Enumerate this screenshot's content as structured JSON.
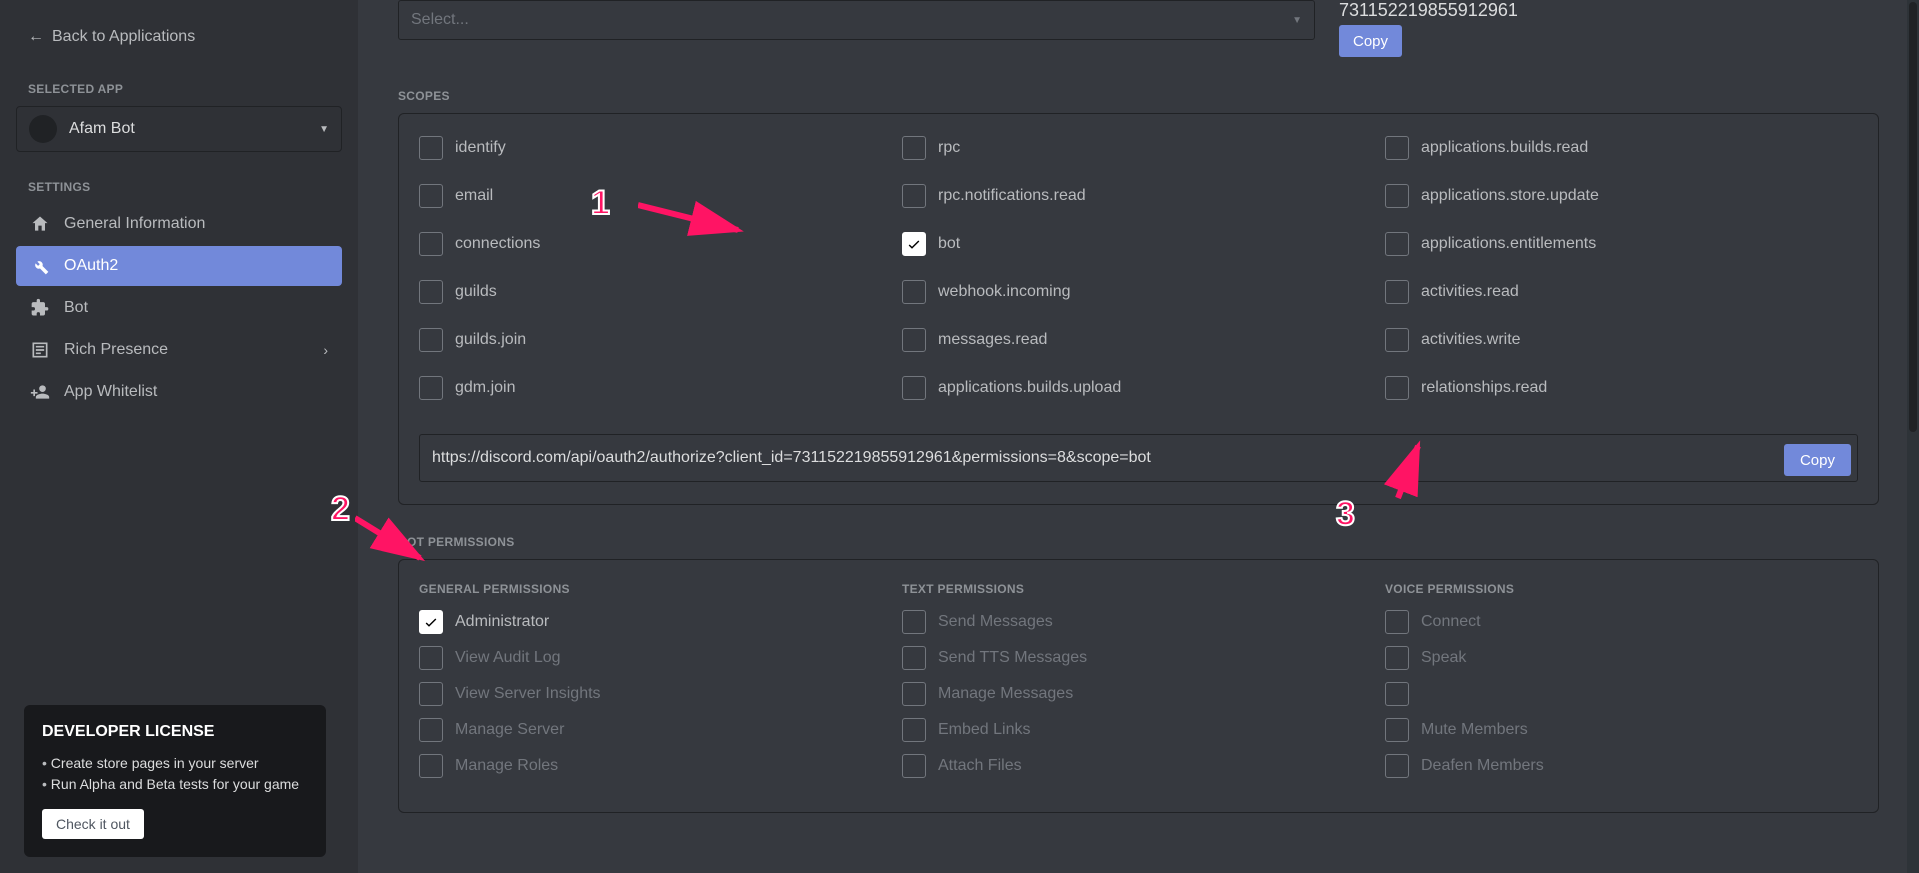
{
  "sidebar": {
    "back_label": "Back to Applications",
    "selected_app_header": "Selected App",
    "app_name": "Afam Bot",
    "settings_header": "Settings",
    "nav": [
      {
        "id": "general",
        "label": "General Information"
      },
      {
        "id": "oauth2",
        "label": "OAuth2"
      },
      {
        "id": "bot",
        "label": "Bot"
      },
      {
        "id": "rich-presence",
        "label": "Rich Presence"
      },
      {
        "id": "app-whitelist",
        "label": "App Whitelist"
      }
    ],
    "promo": {
      "title": "DEVELOPER LICENSE",
      "bullets": [
        "Create store pages in your server",
        "Run Alpha and Beta tests for your game"
      ],
      "button": "Check it out"
    }
  },
  "main": {
    "select_placeholder": "Select...",
    "client_id": "731152219855912961",
    "copy_label": "Copy",
    "scopes_header": "Scopes",
    "scopes": {
      "col1": [
        {
          "label": "identify",
          "checked": false
        },
        {
          "label": "email",
          "checked": false
        },
        {
          "label": "connections",
          "checked": false
        },
        {
          "label": "guilds",
          "checked": false
        },
        {
          "label": "guilds.join",
          "checked": false
        },
        {
          "label": "gdm.join",
          "checked": false
        }
      ],
      "col2": [
        {
          "label": "rpc",
          "checked": false
        },
        {
          "label": "rpc.notifications.read",
          "checked": false
        },
        {
          "label": "bot",
          "checked": true
        },
        {
          "label": "webhook.incoming",
          "checked": false
        },
        {
          "label": "messages.read",
          "checked": false
        },
        {
          "label": "applications.builds.upload",
          "checked": false
        }
      ],
      "col3": [
        {
          "label": "applications.builds.read",
          "checked": false
        },
        {
          "label": "applications.store.update",
          "checked": false
        },
        {
          "label": "applications.entitlements",
          "checked": false
        },
        {
          "label": "activities.read",
          "checked": false
        },
        {
          "label": "activities.write",
          "checked": false
        },
        {
          "label": "relationships.read",
          "checked": false
        }
      ]
    },
    "auth_url": "https://discord.com/api/oauth2/authorize?client_id=731152219855912961&permissions=8&scope=bot",
    "bot_permissions_header": "Bot Permissions",
    "perm_headers": {
      "general": "General Permissions",
      "text": "Text Permissions",
      "voice": "Voice Permissions"
    },
    "permissions": {
      "general": [
        {
          "label": "Administrator",
          "checked": true,
          "disabled": false
        },
        {
          "label": "View Audit Log",
          "checked": false,
          "disabled": true
        },
        {
          "label": "View Server Insights",
          "checked": false,
          "disabled": true
        },
        {
          "label": "Manage Server",
          "checked": false,
          "disabled": true
        },
        {
          "label": "Manage Roles",
          "checked": false,
          "disabled": true
        }
      ],
      "text": [
        {
          "label": "Send Messages",
          "checked": false,
          "disabled": true
        },
        {
          "label": "Send TTS Messages",
          "checked": false,
          "disabled": true
        },
        {
          "label": "Manage Messages",
          "checked": false,
          "disabled": true
        },
        {
          "label": "Embed Links",
          "checked": false,
          "disabled": true
        },
        {
          "label": "Attach Files",
          "checked": false,
          "disabled": true
        }
      ],
      "voice": [
        {
          "label": "Connect",
          "checked": false,
          "disabled": true
        },
        {
          "label": "Speak",
          "checked": false,
          "disabled": true
        },
        {
          "label": "",
          "checked": false,
          "disabled": true
        },
        {
          "label": "Mute Members",
          "checked": false,
          "disabled": true
        },
        {
          "label": "Deafen Members",
          "checked": false,
          "disabled": true
        }
      ]
    }
  },
  "annotations": {
    "n1": "1",
    "n2": "2",
    "n3": "3"
  }
}
